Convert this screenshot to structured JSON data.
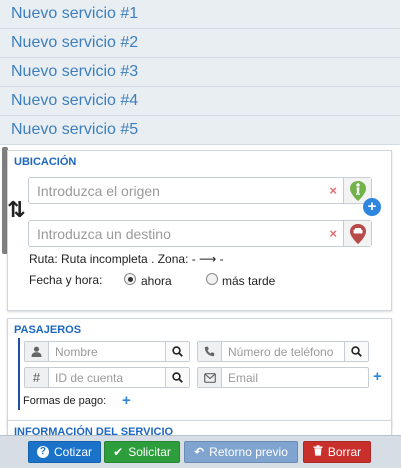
{
  "services": [
    "Nuevo servicio #1",
    "Nuevo servicio #2",
    "Nuevo servicio #3",
    "Nuevo servicio #4",
    "Nuevo servicio #5"
  ],
  "ubicacion": {
    "title": "UBICACIÓN",
    "origin_placeholder": "Introduzca el origen",
    "destination_placeholder": "Introduzca un destino",
    "clear_icon": "×",
    "ruta_text": "Ruta: Ruta incompleta . Zona: -",
    "ruta_arrow": "⟶",
    "ruta_dash": "-",
    "fecha_label": "Fecha y hora:",
    "option_now": "ahora",
    "option_later": "más tarde",
    "selected": "ahora"
  },
  "pasajeros": {
    "title": "PASAJEROS",
    "name_placeholder": "Nombre",
    "phone_placeholder": "Número de teléfono",
    "account_placeholder": "ID de cuenta",
    "email_placeholder": "Email",
    "payment_label": "Formas de pago:"
  },
  "info": {
    "title": "INFORMACIÓN DEL SERVICIO"
  },
  "buttons": {
    "cotizar": "Cotizar",
    "solicitar": "Solicitar",
    "retorno": "Retorno previo",
    "borrar": "Borrar"
  },
  "colors": {
    "accent": "#3d7fbc",
    "section_title": "#1c67c1",
    "cotizar": "#1a73c9",
    "solicitar": "#2e9e3c",
    "retorno": "#7fa4cf",
    "borrar": "#c9302c"
  }
}
